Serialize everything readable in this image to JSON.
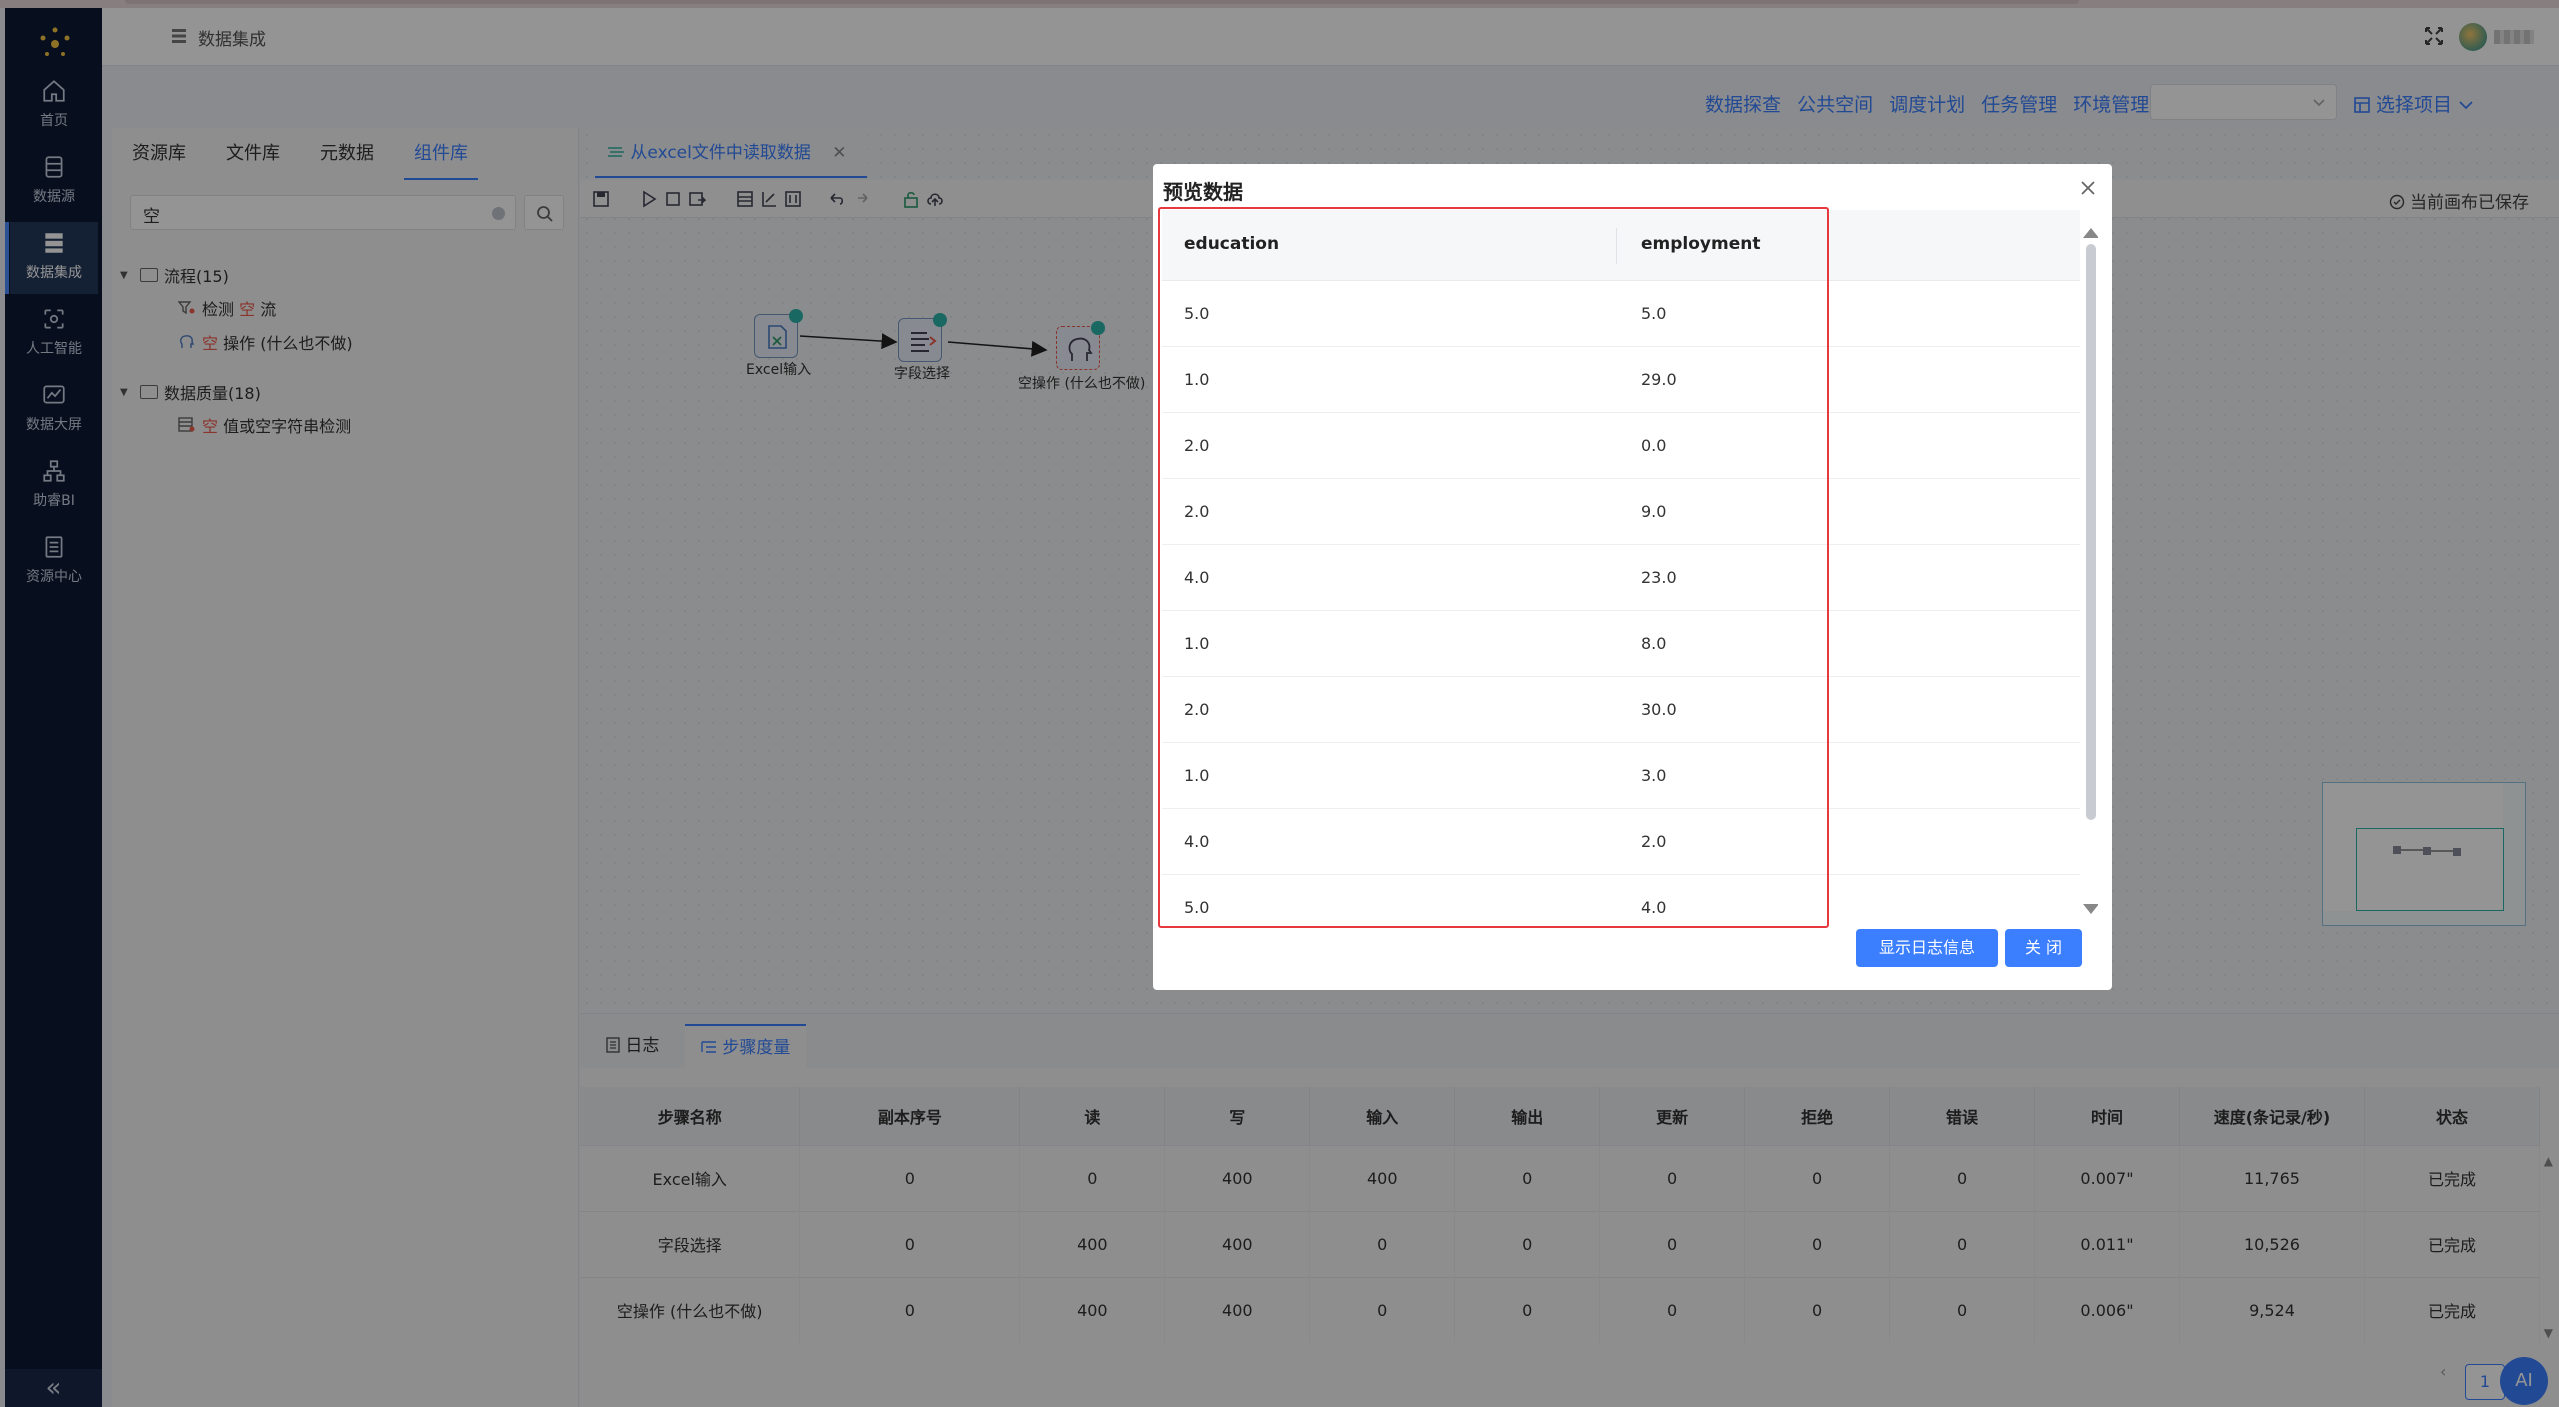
{
  "colors": {
    "accent": "#3b7fff",
    "sidebar_bg": "#0d1b36",
    "highlight_frame": "#e6383d",
    "node_ok": "#2cb3a8"
  },
  "sidebar": {
    "items": [
      {
        "label": "首页",
        "icon": "home-icon"
      },
      {
        "label": "数据源",
        "icon": "database-icon"
      },
      {
        "label": "数据集成",
        "icon": "layers-icon"
      },
      {
        "label": "人工智能",
        "icon": "ai-icon"
      },
      {
        "label": "数据大屏",
        "icon": "chart-icon"
      },
      {
        "label": "助睿BI",
        "icon": "org-icon"
      },
      {
        "label": "资源中心",
        "icon": "resource-icon"
      }
    ],
    "collapse": "«"
  },
  "header": {
    "title": "数据集成"
  },
  "top_links": [
    "数据探查",
    "公共空间",
    "调度计划",
    "任务管理",
    "环境管理"
  ],
  "choose_project": "选择项目",
  "left_panel": {
    "tabs": [
      "资源库",
      "文件库",
      "元数据",
      "组件库"
    ],
    "search_value": "空",
    "tree": {
      "group1": "流程(15)",
      "g1_item1_pre": "检测 ",
      "g1_item1_hl": "空",
      "g1_item1_post": " 流",
      "g1_item2_hl": "空",
      "g1_item2_post": " 操作 (什么也不做)",
      "group2": "数据质量(18)",
      "g2_item1_hl": "空",
      "g2_item1_post": " 值或空字符串检测"
    }
  },
  "canvas": {
    "doc_tab": "从excel文件中读取数据",
    "saved_note": "当前画布已保存",
    "nodes": [
      "Excel输入",
      "字段选择",
      "空操作 (什么也不做)"
    ]
  },
  "bottom": {
    "tabs": [
      "日志",
      "步骤度量"
    ],
    "columns": [
      "步骤名称",
      "副本序号",
      "读",
      "写",
      "输入",
      "输出",
      "更新",
      "拒绝",
      "错误",
      "时间",
      "速度(条记录/秒)",
      "状态"
    ],
    "rows": [
      [
        "Excel输入",
        "0",
        "0",
        "400",
        "400",
        "0",
        "0",
        "0",
        "0",
        "0.007\"",
        "11,765",
        "已完成"
      ],
      [
        "字段选择",
        "0",
        "400",
        "400",
        "0",
        "0",
        "0",
        "0",
        "0",
        "0.011\"",
        "10,526",
        "已完成"
      ],
      [
        "空操作 (什么也不做)",
        "0",
        "400",
        "400",
        "0",
        "0",
        "0",
        "0",
        "0",
        "0.006\"",
        "9,524",
        "已完成"
      ]
    ],
    "page": "1",
    "ai": "AI"
  },
  "modal": {
    "title": "预览数据",
    "columns": [
      "education",
      "employment"
    ],
    "rows": [
      [
        "5.0",
        "5.0"
      ],
      [
        "1.0",
        "29.0"
      ],
      [
        "2.0",
        "0.0"
      ],
      [
        "2.0",
        "9.0"
      ],
      [
        "4.0",
        "23.0"
      ],
      [
        "1.0",
        "8.0"
      ],
      [
        "2.0",
        "30.0"
      ],
      [
        "1.0",
        "3.0"
      ],
      [
        "4.0",
        "2.0"
      ],
      [
        "5.0",
        "4.0"
      ]
    ],
    "log_button": "显示日志信息",
    "close_button": "关 闭"
  }
}
